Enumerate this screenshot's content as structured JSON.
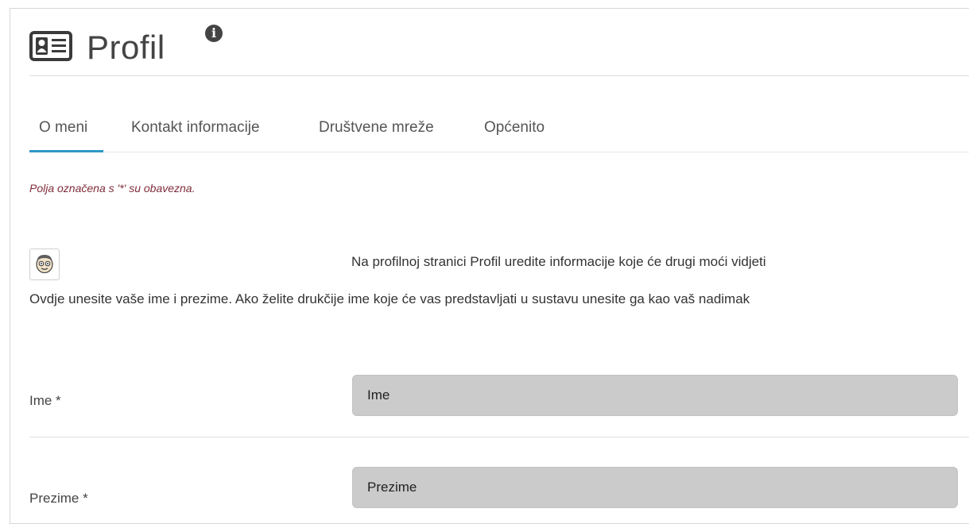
{
  "header": {
    "title": "Profil",
    "info_icon": "info-icon",
    "title_icon": "profile-card-icon"
  },
  "tabs": [
    {
      "label": "O meni",
      "active": true
    },
    {
      "label": "Kontakt informacije",
      "active": false
    },
    {
      "label": "Društvene mreže",
      "active": false
    },
    {
      "label": "Općenito",
      "active": false
    }
  ],
  "form": {
    "required_note": "Polja označena s '*' su obavezna.",
    "avatar_icon": "avatar-face-icon",
    "profile_hint": "Na profilnoj stranici Profil uredite informacije koje će drugi moći vidjeti",
    "name_hint": "Ovdje unesite vaše ime i prezime. Ako želite drukčije ime koje će vas predstavljati u sustavu unesite ga kao vaš nadimak",
    "fields": [
      {
        "label": "Ime *",
        "value": "Ime"
      },
      {
        "label": "Prezime *",
        "value": "Prezime"
      }
    ]
  },
  "colors": {
    "accent": "#2e96c6",
    "required_note": "#7f2d3a",
    "input_background": "#cbcbcb"
  }
}
